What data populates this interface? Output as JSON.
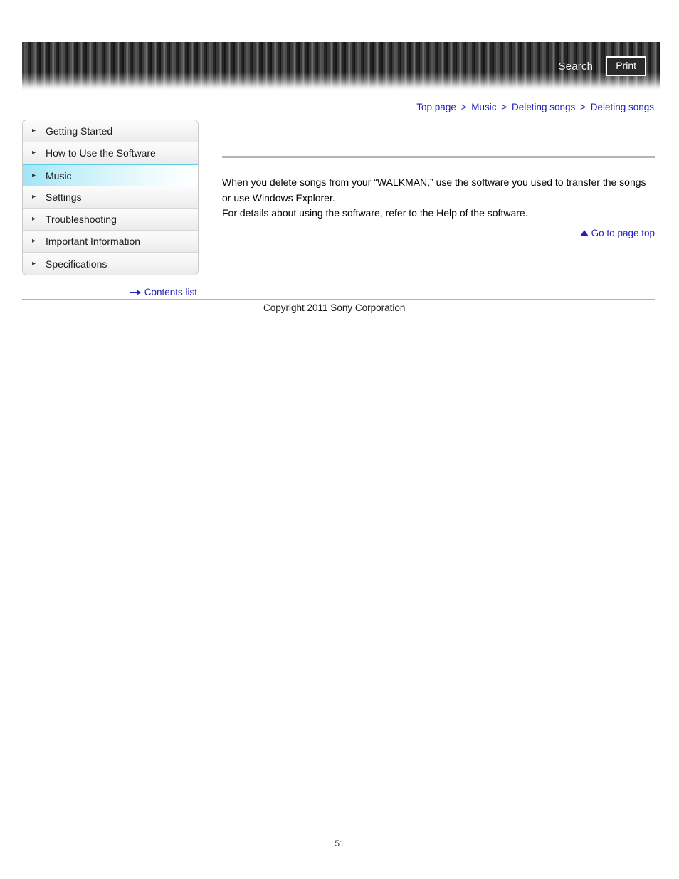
{
  "header": {
    "search_label": "Search",
    "print_label": "Print",
    "search_icon": "search-icon",
    "print_icon": "print-icon"
  },
  "breadcrumb": {
    "separator": ">",
    "items": [
      {
        "label": "Top page"
      },
      {
        "label": "Music"
      },
      {
        "label": "Deleting songs"
      },
      {
        "label": "Deleting songs"
      }
    ]
  },
  "sidebar": {
    "bullet_glyph": "▸",
    "items": [
      {
        "label": "Getting Started",
        "active": false
      },
      {
        "label": "How to Use the Software",
        "active": false
      },
      {
        "label": "Music",
        "active": true
      },
      {
        "label": "Settings",
        "active": false
      },
      {
        "label": "Troubleshooting",
        "active": false
      },
      {
        "label": "Important Information",
        "active": false
      },
      {
        "label": "Specifications",
        "active": false
      }
    ],
    "contents_list_label": "Contents list",
    "contents_list_icon": "arrow-right-icon"
  },
  "content": {
    "paragraphs": [
      "When you delete songs from your “WALKMAN,” use the software you used to transfer the songs or use Windows Explorer.",
      "For details about using the software, refer to the Help of the software."
    ],
    "go_to_top_label": "Go to page top",
    "go_to_top_icon": "triangle-up-icon"
  },
  "footer": {
    "copyright": "Copyright 2011 Sony Corporation",
    "page_number": "51"
  },
  "colors": {
    "link": "#2222bb",
    "active_nav": "#9fe4f5",
    "rule": "#b5b5b5",
    "banner_dark": "#171717"
  }
}
